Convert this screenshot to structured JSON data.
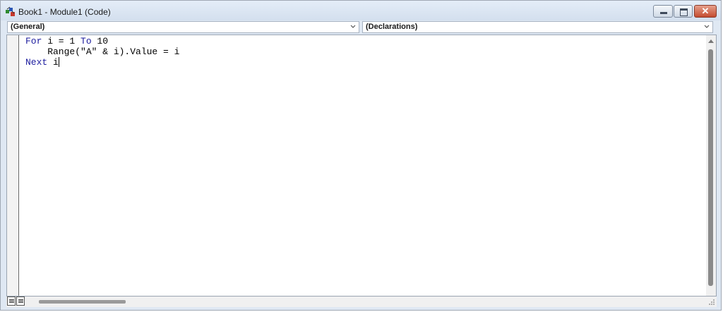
{
  "window": {
    "title": "Book1 - Module1 (Code)",
    "close_glyph": "✕"
  },
  "selectors": {
    "object": "(General)",
    "procedure": "(Declarations)"
  },
  "code": {
    "lines": [
      {
        "kw1": "For",
        "text": " i = 1 ",
        "kw2": "To",
        "tail": " 10"
      },
      {
        "text": "    Range(\"A\" & i).Value = i"
      },
      {
        "kw1": "Next",
        "text": " i"
      }
    ]
  },
  "icons": [
    "vba-module-icon",
    "minimize-icon",
    "maximize-icon",
    "close-icon",
    "chevron-down-icon",
    "procedure-view-icon",
    "full-module-view-icon",
    "resize-grip-icon"
  ]
}
